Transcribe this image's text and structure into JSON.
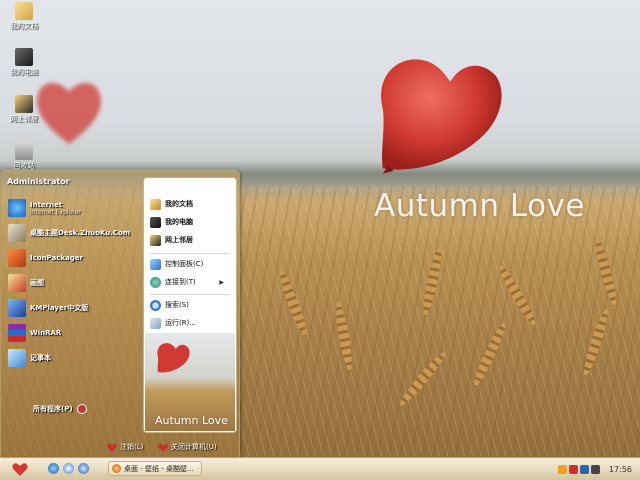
{
  "wallpaper": {
    "title": "Autumn Love",
    "heart_color": "#d03a32"
  },
  "desktop_icons": [
    {
      "label": "我的文档",
      "icon": "my-documents-icon"
    },
    {
      "label": "我的电脑",
      "icon": "my-computer-icon"
    },
    {
      "label": "网上邻居",
      "icon": "network-places-icon"
    },
    {
      "label": "回收站",
      "icon": "recycle-bin-icon"
    }
  ],
  "start_menu": {
    "user": "Administrator",
    "pinned": [
      {
        "label": "Internet",
        "sub": "Internet Explorer",
        "icon": "internet-explorer-icon"
      },
      {
        "label": "桌酷主题Desk.ZhuoKu.Com",
        "icon": "zhuoku-icon"
      },
      {
        "label": "IconPackager",
        "icon": "iconpackager-icon"
      },
      {
        "label": "画图",
        "icon": "paint-icon"
      },
      {
        "label": "KMPlayer中文版",
        "icon": "kmplayer-icon"
      },
      {
        "label": "WinRAR",
        "icon": "winrar-icon"
      },
      {
        "label": "记事本",
        "icon": "notepad-icon"
      }
    ],
    "all_programs": "所有程序(P)",
    "right": [
      {
        "label": "我的文档",
        "icon": "my-documents-icon"
      },
      {
        "label": "我的电脑",
        "icon": "my-computer-icon"
      },
      {
        "label": "网上邻居",
        "icon": "network-places-icon"
      },
      {
        "label": "控制面板(C)",
        "icon": "control-panel-icon"
      },
      {
        "label": "连接到(T)",
        "icon": "connect-to-icon"
      },
      {
        "label": "搜索(S)",
        "icon": "search-icon"
      },
      {
        "label": "运行(R)...",
        "icon": "run-icon"
      }
    ],
    "photo_title": "Autumn Love",
    "logoff": "注销(L)",
    "shutdown": "关闭计算机(U)"
  },
  "taskbar": {
    "task_label": "桌面 - 壁纸 - 桌酷壁...",
    "clock": "17:56"
  }
}
